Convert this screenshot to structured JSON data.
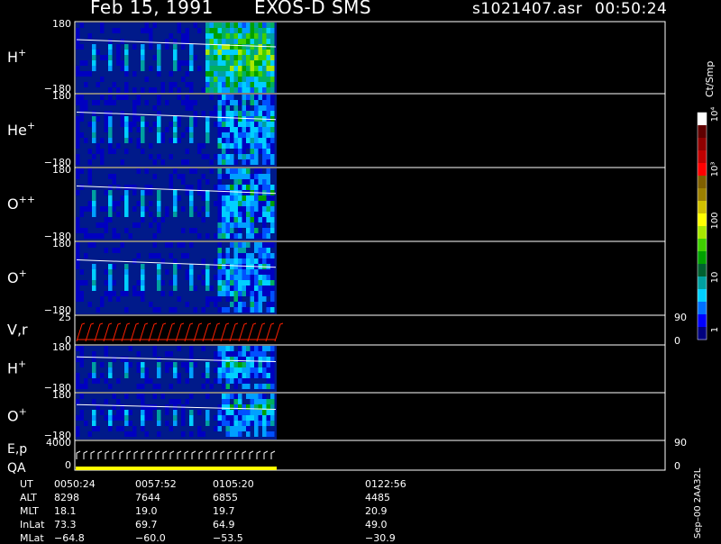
{
  "header": {
    "date": "Feb 15, 1991",
    "mission": "EXOS-D SMS",
    "file": "s1021407.asr",
    "time": "00:50:24"
  },
  "colorbar": {
    "unit_label": "Ct/Smp",
    "tick_labels": [
      "1",
      "10",
      "100",
      "10³",
      "10⁴"
    ],
    "colors": [
      "#00007e",
      "#0000ff",
      "#0070ff",
      "#00d0ff",
      "#00a0a0",
      "#006030",
      "#00a000",
      "#40d000",
      "#a8e800",
      "#ffff00",
      "#d0c000",
      "#9c8000",
      "#806000",
      "#ff0000",
      "#c00000",
      "#900000",
      "#600000",
      "#ffffff"
    ]
  },
  "side_label": "Sep–00 2AA32L",
  "chart_data": [
    {
      "type": "heatmap",
      "panel": "H+",
      "label": "H",
      "sup": "+",
      "y_top": "180",
      "y_bot": "−180",
      "mid_tick": ""
    },
    {
      "type": "heatmap",
      "panel": "He+",
      "label": "He",
      "sup": "+",
      "y_top": "180",
      "y_bot": "−180",
      "mid_tick": ""
    },
    {
      "type": "heatmap",
      "panel": "O++",
      "label": "O",
      "sup": "++",
      "y_top": "180",
      "y_bot": "−180",
      "mid_tick": ""
    },
    {
      "type": "heatmap",
      "panel": "O+",
      "label": "O",
      "sup": "+",
      "y_top": "180",
      "y_bot": "−180",
      "mid_tick": ""
    },
    {
      "type": "line",
      "panel": "V,r",
      "label": "V,r",
      "sup": "",
      "y_top": "25",
      "y_bot": "0",
      "right_top": "90",
      "right_bot": "0",
      "line_color": "#ff2000"
    },
    {
      "type": "heatmap",
      "panel": "H+ (2)",
      "label": "H",
      "sup": "+",
      "y_top": "180",
      "y_bot": "−180"
    },
    {
      "type": "heatmap",
      "panel": "O+ (2)",
      "label": "O",
      "sup": "+",
      "y_top": "180",
      "y_bot": "−180"
    },
    {
      "type": "line",
      "panel": "E,p QA",
      "label": "E,p",
      "label2": "QA",
      "sup": "",
      "y_top": "4000",
      "y_bot": "0",
      "right_top": "90",
      "right_bot": "0",
      "qa_color": "#ffff00"
    }
  ],
  "table": {
    "rows": [
      {
        "name": "UT",
        "values": [
          "0050:24",
          "0057:52",
          "0105:20",
          "0122:56"
        ]
      },
      {
        "name": "ALT",
        "values": [
          "8298",
          "7644",
          "6855",
          "4485"
        ]
      },
      {
        "name": "MLT",
        "values": [
          "18.1",
          "19.0",
          "19.7",
          "20.9"
        ]
      },
      {
        "name": "InLat",
        "values": [
          "73.3",
          "69.7",
          "64.9",
          "49.0"
        ]
      },
      {
        "name": "MLat",
        "values": [
          "−64.8",
          "−60.0",
          "−53.5",
          "−30.9"
        ]
      }
    ]
  }
}
